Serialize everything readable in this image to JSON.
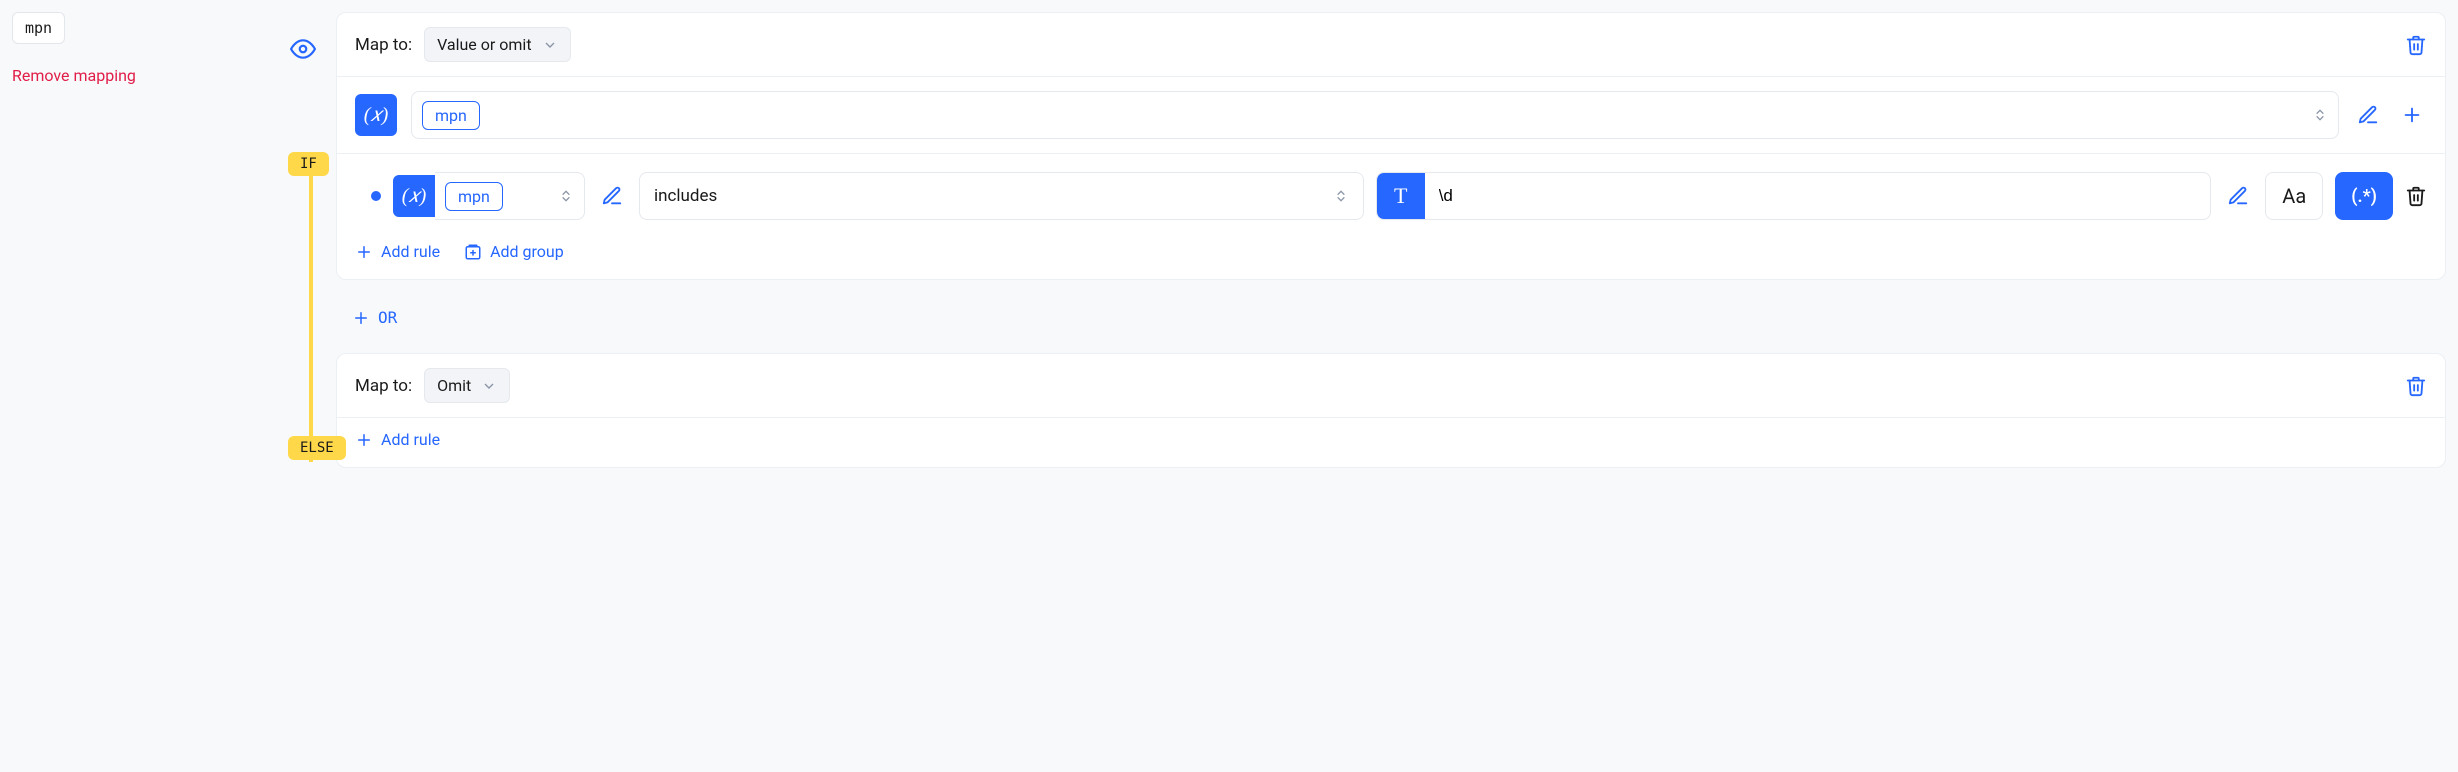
{
  "left": {
    "field_tag": "mpn",
    "remove_label": "Remove mapping"
  },
  "branches": {
    "if_label": "IF",
    "else_label": "ELSE"
  },
  "if_card": {
    "map_to_label": "Map to:",
    "map_to_value": "Value or omit",
    "variable_token": "mpn",
    "rule": {
      "variable": "mpn",
      "operator": "includes",
      "text_value": "\\d",
      "case_label": "Aa",
      "regex_label": "(.*)"
    },
    "add_rule_label": "Add rule",
    "add_group_label": "Add group"
  },
  "or_label": "OR",
  "else_card": {
    "map_to_label": "Map to:",
    "map_to_value": "Omit",
    "add_rule_label": "Add rule"
  }
}
